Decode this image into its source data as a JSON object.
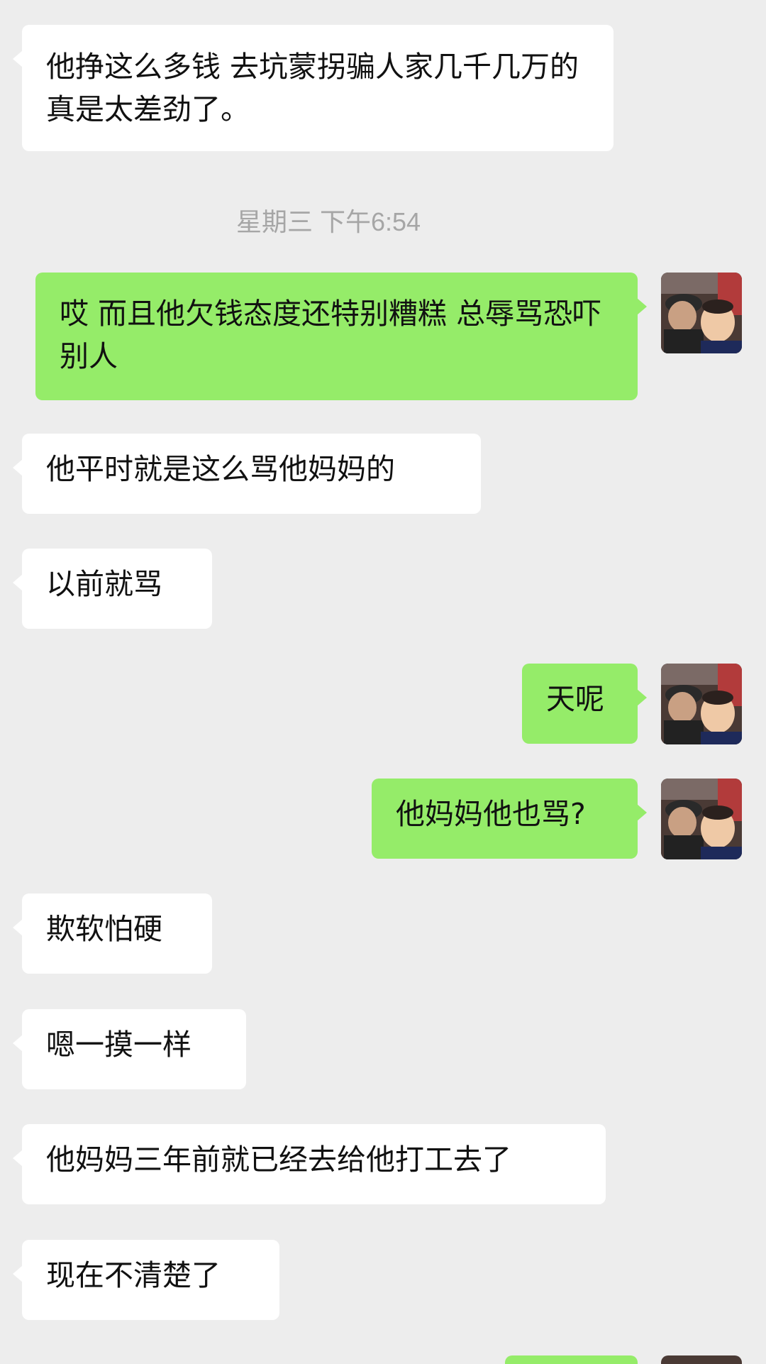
{
  "chat": {
    "timestamp": "星期三 下午6:54",
    "messages": [
      {
        "side": "in",
        "text": "他挣这么多钱 去坑蒙拐骗人家几千几万的 真是太差劲了。"
      },
      {
        "side": "out",
        "text": "哎 而且他欠钱态度还特别糟糕 总辱骂恐吓别人"
      },
      {
        "side": "in",
        "text": "他平时就是这么骂他妈妈的"
      },
      {
        "side": "in",
        "text": "以前就骂"
      },
      {
        "side": "out",
        "text": "天呢"
      },
      {
        "side": "out",
        "text": "他妈妈他也骂?"
      },
      {
        "side": "in",
        "text": "欺软怕硬"
      },
      {
        "side": "in",
        "text": "嗯一摸一样"
      },
      {
        "side": "in",
        "text": "他妈妈三年前就已经去给他打工去了"
      },
      {
        "side": "in",
        "text": "现在不清楚了"
      }
    ],
    "avatar_icon": "user-avatar-photo"
  }
}
